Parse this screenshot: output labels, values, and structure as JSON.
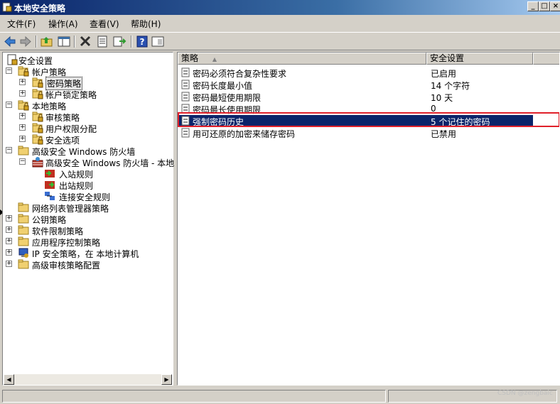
{
  "window": {
    "title": "本地安全策略"
  },
  "menu": [
    "文件(F)",
    "操作(A)",
    "查看(V)",
    "帮助(H)"
  ],
  "toolbar": [
    "back-icon",
    "forward-icon",
    "up-folder-icon",
    "show-tree-icon",
    "delete-icon",
    "properties-icon",
    "export-icon",
    "help-icon",
    "console-tree-icon"
  ],
  "tree": [
    {
      "label": "安全设置",
      "expander": "",
      "icon": "security-settings-icon"
    },
    {
      "label": "帐户策略",
      "expander": "−",
      "icon": "folder-lock-icon"
    },
    {
      "label": "密码策略",
      "expander": "+",
      "icon": "folder-lock-icon"
    },
    {
      "label": "帐户锁定策略",
      "expander": "+",
      "icon": "folder-lock-icon"
    },
    {
      "label": "本地策略",
      "expander": "−",
      "icon": "folder-lock-icon"
    },
    {
      "label": "审核策略",
      "expander": "+",
      "icon": "folder-lock-icon"
    },
    {
      "label": "用户权限分配",
      "expander": "+",
      "icon": "folder-lock-icon"
    },
    {
      "label": "安全选项",
      "expander": "+",
      "icon": "folder-lock-icon"
    },
    {
      "label": "高级安全 Windows 防火墙",
      "expander": "−",
      "icon": "folder-icon"
    },
    {
      "label": "高级安全 Windows 防火墙 - 本地",
      "expander": "−",
      "icon": "firewall-icon"
    },
    {
      "label": "入站规则",
      "expander": "",
      "icon": "inbound-rules-icon"
    },
    {
      "label": "出站规则",
      "expander": "",
      "icon": "outbound-rules-icon"
    },
    {
      "label": "连接安全规则",
      "expander": "",
      "icon": "connection-rules-icon"
    },
    {
      "label": "网络列表管理器策略",
      "expander": "",
      "icon": "folder-icon"
    },
    {
      "label": "公钥策略",
      "expander": "+",
      "icon": "folder-icon"
    },
    {
      "label": "软件限制策略",
      "expander": "+",
      "icon": "folder-icon"
    },
    {
      "label": "应用程序控制策略",
      "expander": "+",
      "icon": "folder-icon"
    },
    {
      "label": "IP 安全策略，在 本地计算机",
      "expander": "+",
      "icon": "ip-security-icon"
    },
    {
      "label": "高级审核策略配置",
      "expander": "+",
      "icon": "folder-icon"
    }
  ],
  "list": {
    "columns": [
      "策略",
      "安全设置"
    ],
    "sort_indicator": "▲",
    "rows": [
      {
        "policy": "密码必须符合复杂性要求",
        "setting": "已启用"
      },
      {
        "policy": "密码长度最小值",
        "setting": "14 个字符"
      },
      {
        "policy": "密码最短使用期限",
        "setting": "10 天"
      },
      {
        "policy": "密码最长使用期限",
        "setting": "0"
      },
      {
        "policy": "强制密码历史",
        "setting": "5 个记住的密码"
      },
      {
        "policy": "用可还原的加密来储存密码",
        "setting": "已禁用"
      }
    ]
  },
  "watermark": "CSDN @zengbaic"
}
